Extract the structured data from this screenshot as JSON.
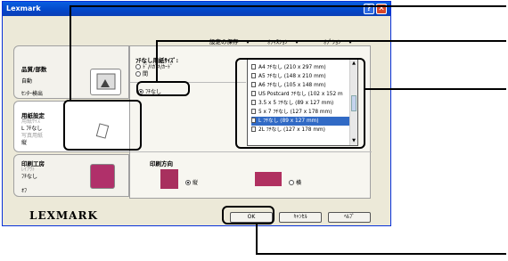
{
  "window": {
    "title": "Lexmark",
    "help": "?",
    "close": "✕"
  },
  "menus": [
    "設定の保存",
    "ｵﾌｨｽｼｮﾝ",
    "ｵﾌﾟｼｮﾝ"
  ],
  "left_tabs": [
    {
      "title": "品質/部数",
      "lines": [
        "",
        "自動",
        "",
        "ｾﾝﾀｰ検出"
      ]
    },
    {
      "title": "用紙設定",
      "lines": [
        "用紙ｻｲｽﾞ",
        "L ﾌﾁなし",
        "写真用紙",
        "縦"
      ]
    },
    {
      "title": "印刷工房",
      "lines": [
        "ﾚｲｱｳﾄ",
        "ﾌﾁなし",
        "",
        "ｵﾌ"
      ]
    }
  ],
  "paper_size": {
    "label": "ﾌﾁなし用紙ｻｲｽﾞ:",
    "options": [
      "ﾄﾞ/ﾊｶﾞｷ/ｶｰﾄﾞ",
      "間"
    ],
    "selected_type": "ﾌﾁなし",
    "list": [
      "A4 ﾌﾁなし (210 x 297 mm)",
      "A5 ﾌﾁなし (148 x 210 mm)",
      "A6 ﾌﾁなし (105 x 148 mm)",
      "US Postcard ﾌﾁなし (102 x 152 m",
      "3.5 x 5 ﾌﾁなし (89 x 127 mm)",
      "5 x 7 ﾌﾁなし (127 x 178 mm)",
      "L ﾌﾁなし (89 x 127 mm)",
      "2L ﾌﾁなし (127 x 178 mm)"
    ],
    "selected_index": 6
  },
  "orientation": {
    "label": "印刷方向",
    "portrait": "縦",
    "landscape": "横"
  },
  "brand": "LEXMARK",
  "buttons": {
    "ok": "OK",
    "cancel": "ｷｬﾝｾﾙ",
    "help": "ﾍﾙﾌﾟ"
  }
}
